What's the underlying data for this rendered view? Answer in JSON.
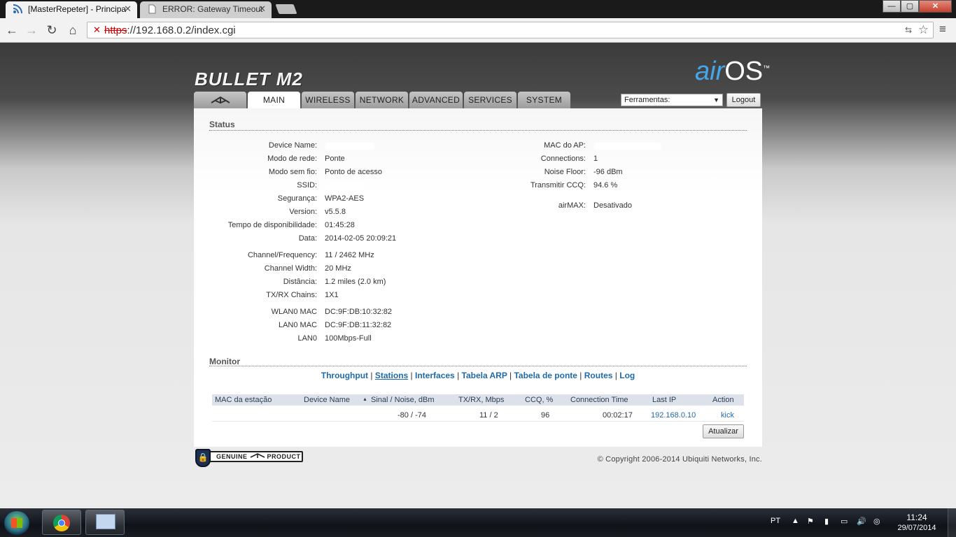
{
  "browser": {
    "tabs": [
      {
        "label": "[MasterRepeter] - Principa"
      },
      {
        "label": "ERROR: Gateway Timeout"
      }
    ],
    "url_scheme": "https",
    "url_rest": "://192.168.0.2/index.cgi",
    "window_buttons": {
      "minimize": "—",
      "maximize": "▢",
      "close": "✕"
    }
  },
  "header": {
    "product": "BULLET M2",
    "brand_air": "air",
    "brand_os": "OS",
    "tm": "™"
  },
  "nav": {
    "tabs": [
      {
        "label": "",
        "icon": "ubiquiti-logo-icon"
      },
      {
        "label": "MAIN",
        "active": true
      },
      {
        "label": "WIRELESS"
      },
      {
        "label": "NETWORK"
      },
      {
        "label": "ADVANCED"
      },
      {
        "label": "SERVICES"
      },
      {
        "label": "SYSTEM"
      }
    ],
    "tools_select": "Ferramentas:",
    "logout": "Logout"
  },
  "status": {
    "title": "Status",
    "left": [
      {
        "label": "Device Name:",
        "value": ""
      },
      {
        "label": "Modo de rede:",
        "value": "Ponte"
      },
      {
        "label": "Modo sem fio:",
        "value": "Ponto de acesso"
      },
      {
        "label": "SSID:",
        "value": ""
      },
      {
        "label": "Segurança:",
        "value": "WPA2-AES"
      },
      {
        "label": "Version:",
        "value": "v5.5.8"
      },
      {
        "label": "Tempo de disponibilidade:",
        "value": "01:45:28"
      },
      {
        "label": "Data:",
        "value": "2014-02-05 20:09:21"
      },
      {
        "label": "Channel/Frequency:",
        "value": "11 / 2462 MHz"
      },
      {
        "label": "Channel Width:",
        "value": "20 MHz"
      },
      {
        "label": "Distância:",
        "value": "1.2 miles (2.0 km)"
      },
      {
        "label": "TX/RX Chains:",
        "value": "1X1"
      },
      {
        "label": "WLAN0 MAC",
        "value": "DC:9F:DB:10:32:82"
      },
      {
        "label": "LAN0 MAC",
        "value": "DC:9F:DB:11:32:82"
      },
      {
        "label": "LAN0",
        "value": "100Mbps-Full"
      }
    ],
    "right": [
      {
        "label": "MAC do AP:",
        "value": ""
      },
      {
        "label": "Connections:",
        "value": "1"
      },
      {
        "label": "Noise Floor:",
        "value": "-96 dBm"
      },
      {
        "label": "Transmitir CCQ:",
        "value": "94.6 %"
      },
      {
        "label": "airMAX:",
        "value": "Desativado"
      }
    ]
  },
  "monitor": {
    "title": "Monitor",
    "links": [
      "Throughput",
      "Stations",
      "Interfaces",
      "Tabela ARP",
      "Tabela de ponte",
      "Routes",
      "Log"
    ],
    "current": "Stations",
    "table": {
      "headers": [
        "MAC da estação",
        "Device Name",
        "▲",
        "Sinal / Noise, dBm",
        "TX/RX, Mbps",
        "CCQ, %",
        "Connection Time",
        "Last IP",
        "Action"
      ],
      "row": {
        "mac": "",
        "device": "",
        "signal": "-80 / -74",
        "txrx": "11 / 2",
        "ccq": "96",
        "conn_time": "00:02:17",
        "last_ip": "192.168.0.10",
        "action": "kick"
      }
    },
    "refresh": "Atualizar"
  },
  "footer": {
    "genuine_left": "GENUINE",
    "genuine_right": "PRODUCT",
    "copyright": "© Copyright 2006-2014 Ubiquiti Networks, Inc."
  },
  "taskbar": {
    "lang": "PT",
    "time": "11:24",
    "date": "29/07/2014"
  },
  "colors": {
    "link": "#1f6aa7",
    "air_blue": "#46a6ec",
    "header_row": "#dde2ea"
  }
}
